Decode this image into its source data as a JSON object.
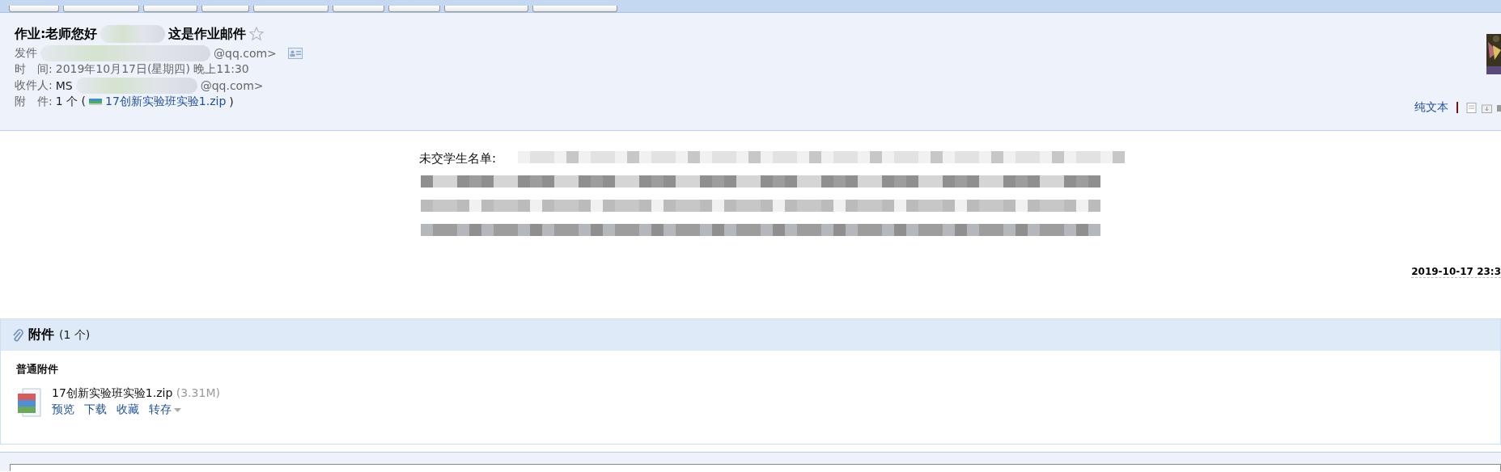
{
  "subject": {
    "parts": [
      "作业:老师您好",
      "这是作业邮件"
    ],
    "starred": false
  },
  "sender": {
    "label": "发件",
    "address_tail": "@qq.com>"
  },
  "time": {
    "label": "时　间:",
    "value": "2019年10月17日(星期四) 晚上11:30"
  },
  "recipient": {
    "label": "收件人:",
    "name_start": "MS",
    "address_tail": "@qq.com>"
  },
  "attachment_line": {
    "label": "附　件:",
    "count": "1 个 (",
    "file": "17创新实验班实验1.zip",
    "close": ")"
  },
  "view_links": {
    "plain_text": "纯文本"
  },
  "body": {
    "first_line": "未交学生名单:"
  },
  "sent_stamp": "2019-10-17 23:3",
  "attachments": {
    "title": "附件",
    "count": "(1 个)",
    "group": "普通附件",
    "files": [
      {
        "name": "17创新实验班实验1.zip",
        "size": "(3.31M)",
        "actions": [
          "预览",
          "下载",
          "收藏",
          "转存"
        ]
      }
    ]
  }
}
